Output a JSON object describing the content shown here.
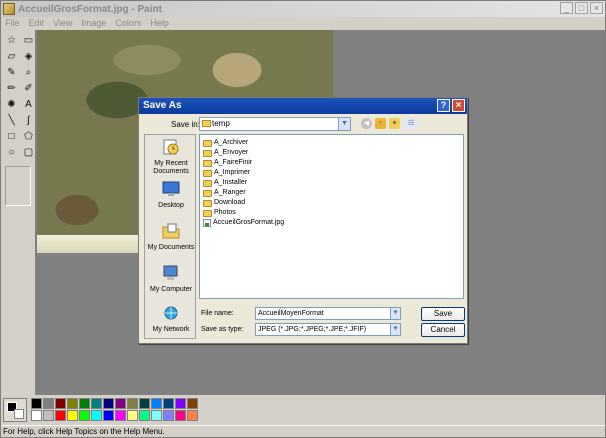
{
  "window": {
    "title": "AccueilGrosFormat.jpg - Paint",
    "minimize": "_",
    "maximize": "□",
    "close": "×"
  },
  "menu": [
    "File",
    "Edit",
    "View",
    "Image",
    "Colors",
    "Help"
  ],
  "tools": [
    {
      "icon": "free-select-icon",
      "glyph": "☆"
    },
    {
      "icon": "rect-select-icon",
      "glyph": "▭"
    },
    {
      "icon": "eraser-icon",
      "glyph": "▱"
    },
    {
      "icon": "fill-icon",
      "glyph": "◈"
    },
    {
      "icon": "picker-icon",
      "glyph": "✎"
    },
    {
      "icon": "magnifier-icon",
      "glyph": "⌕"
    },
    {
      "icon": "pencil-icon",
      "glyph": "✏"
    },
    {
      "icon": "brush-icon",
      "glyph": "✐"
    },
    {
      "icon": "airbrush-icon",
      "glyph": "✺"
    },
    {
      "icon": "text-icon",
      "glyph": "A"
    },
    {
      "icon": "line-icon",
      "glyph": "╲"
    },
    {
      "icon": "curve-icon",
      "glyph": "∫"
    },
    {
      "icon": "rectangle-icon",
      "glyph": "□"
    },
    {
      "icon": "polygon-icon",
      "glyph": "⬠"
    },
    {
      "icon": "ellipse-icon",
      "glyph": "○"
    },
    {
      "icon": "rounded-rect-icon",
      "glyph": "▢"
    }
  ],
  "palette": [
    "#000000",
    "#808080",
    "#800000",
    "#808000",
    "#008000",
    "#008080",
    "#000080",
    "#800080",
    "#808040",
    "#004040",
    "#0080ff",
    "#004080",
    "#8000ff",
    "#804000",
    "#ffffff",
    "#c0c0c0",
    "#ff0000",
    "#ffff00",
    "#00ff00",
    "#00ffff",
    "#0000ff",
    "#ff00ff",
    "#ffff80",
    "#00ff80",
    "#80ffff",
    "#8080ff",
    "#ff0080",
    "#ff8040"
  ],
  "status": "For Help, click Help Topics on the Help Menu.",
  "dialog": {
    "title": "Save As",
    "help": "?",
    "close": "×",
    "save_in_label": "Save in:",
    "save_in_value": "temp",
    "places": [
      "My Recent Documents",
      "Desktop",
      "My Documents",
      "My Computer",
      "My Network"
    ],
    "files": [
      {
        "name": "A_Archiver",
        "type": "folder"
      },
      {
        "name": "A_Envoyer",
        "type": "folder"
      },
      {
        "name": "A_FaireFinir",
        "type": "folder"
      },
      {
        "name": "A_Imprimer",
        "type": "folder"
      },
      {
        "name": "A_Installer",
        "type": "folder"
      },
      {
        "name": "A_Ranger",
        "type": "folder"
      },
      {
        "name": "Download",
        "type": "folder"
      },
      {
        "name": "Photos",
        "type": "folder"
      },
      {
        "name": "AccueilGrosFormat.jpg",
        "type": "image"
      }
    ],
    "file_name_label": "File name:",
    "file_name_value": "AccueilMoyenFormat",
    "save_as_type_label": "Save as type:",
    "save_as_type_value": "JPEG (*.JPG;*.JPEG;*.JPE;*.JFIF)",
    "save_button": "Save",
    "cancel_button": "Cancel"
  }
}
